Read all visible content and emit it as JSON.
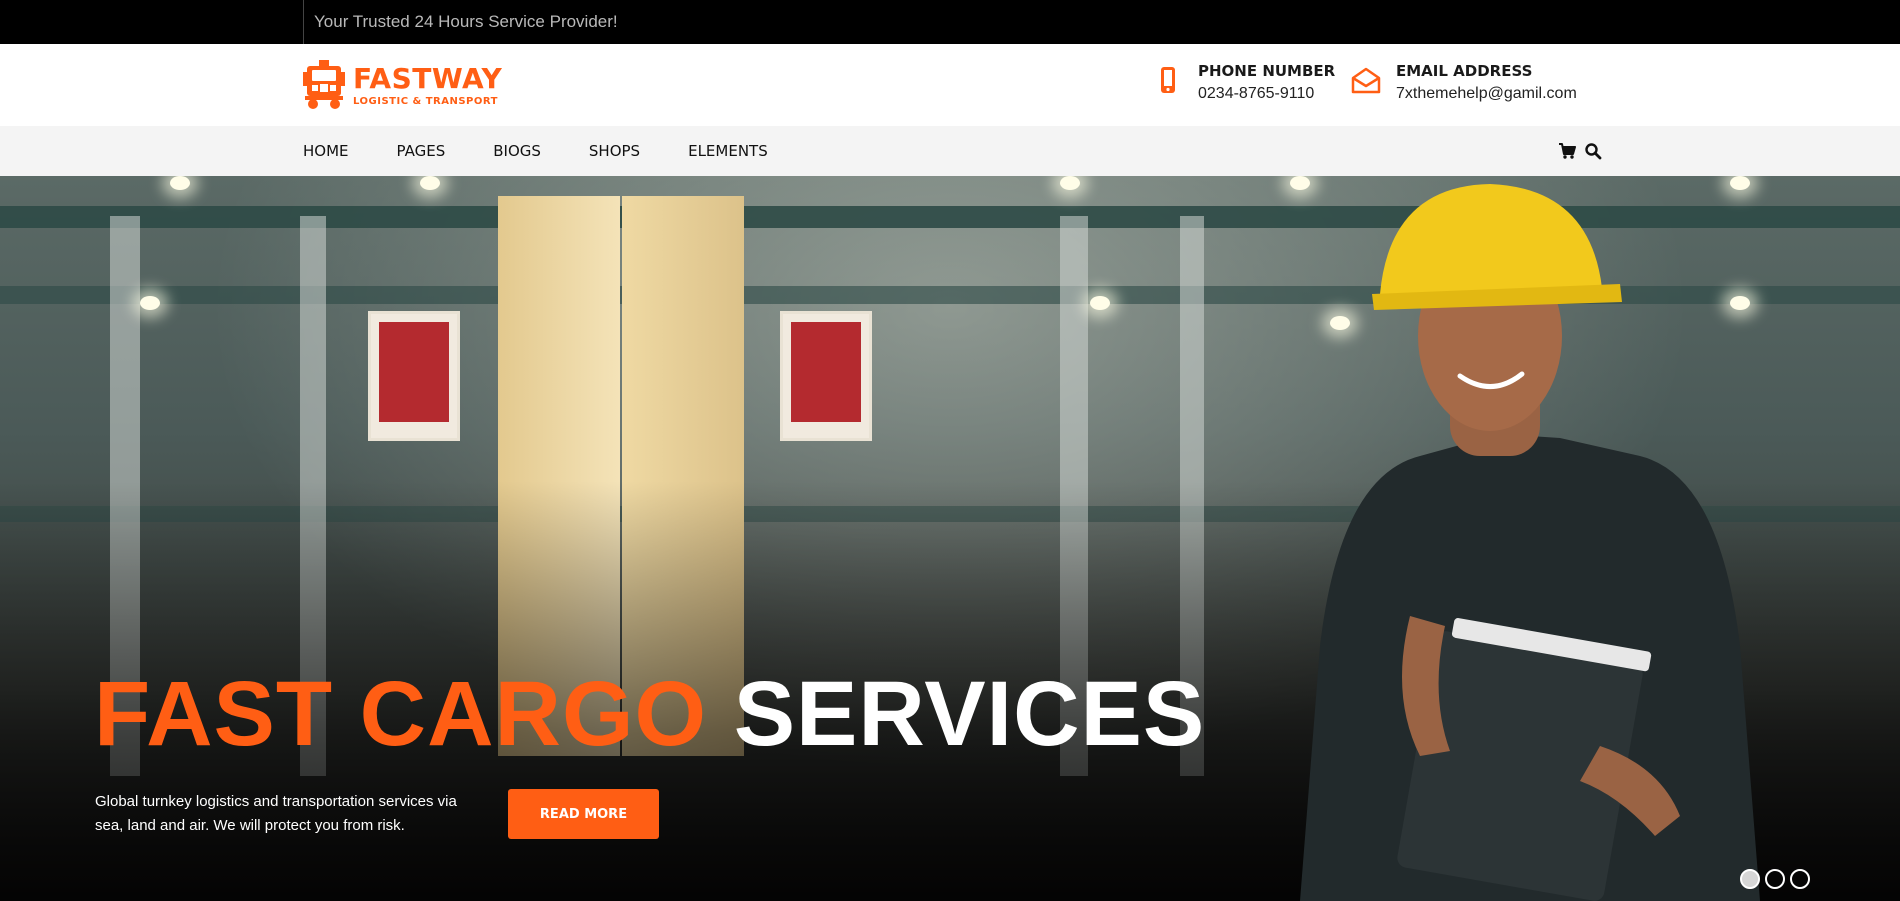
{
  "topbar": {
    "tagline": "Your Trusted 24 Hours Service Provider!"
  },
  "brand": {
    "name": "FASTWAY",
    "subtitle": "LOGISTIC & TRANSPORT",
    "accent_color": "#ff5e14",
    "logo_icon": "truck-icon"
  },
  "contacts": [
    {
      "icon": "mobile-phone-icon",
      "label": "PHONE NUMBER",
      "value": "0234-8765-9110"
    },
    {
      "icon": "envelope-open-icon",
      "label": "EMAIL ADDRESS",
      "value": "7xthemehelp@gamil.com"
    }
  ],
  "nav": {
    "items": [
      "HOME",
      "PAGES",
      "BIOGS",
      "SHOPS",
      "ELEMENTS"
    ],
    "tools": [
      "cart-icon",
      "search-icon"
    ]
  },
  "hero": {
    "title_orange": "FAST CARGO",
    "title_white": "SERVICES",
    "description": "Global turnkey logistics and transportation services via sea, land and air. We will protect you from risk.",
    "cta_label": "READ MORE",
    "slides": {
      "count": 3,
      "active": 1
    }
  }
}
